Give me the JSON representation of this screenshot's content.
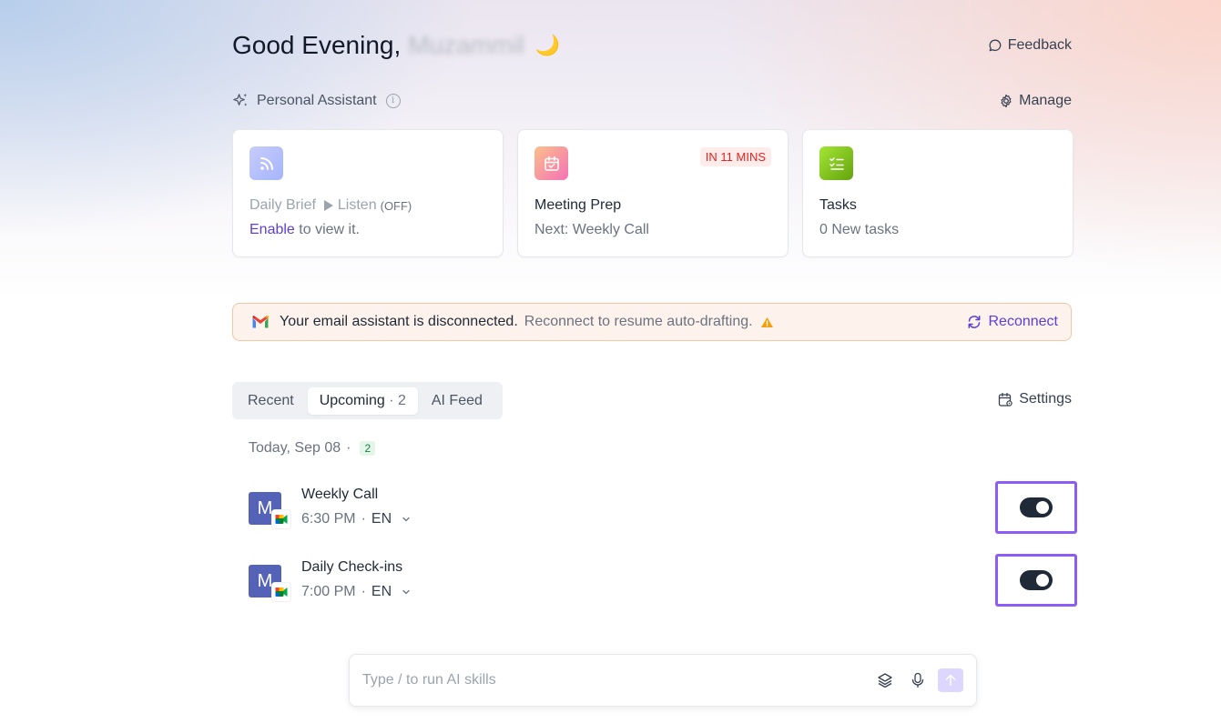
{
  "header": {
    "greeting": "Good Evening,",
    "user_name": "Muzammil",
    "moon": "🌙",
    "feedback_label": "Feedback"
  },
  "assistant": {
    "section_label": "Personal Assistant",
    "info_glyph": "i",
    "manage_label": "Manage"
  },
  "cards": {
    "daily_brief": {
      "title": "Daily Brief",
      "listen_label": "Listen",
      "listen_state": "(OFF)",
      "enable_link": "Enable",
      "enable_rest": "to view it."
    },
    "meeting_prep": {
      "badge": "IN 11 MINS",
      "title": "Meeting Prep",
      "subtitle": "Next: Weekly Call"
    },
    "tasks": {
      "title": "Tasks",
      "subtitle": "0 New tasks"
    }
  },
  "alert": {
    "strong_text": "Your email assistant is disconnected.",
    "light_text": "Reconnect to resume auto-drafting.",
    "reconnect_label": "Reconnect"
  },
  "tabs": {
    "recent": "Recent",
    "upcoming": "Upcoming",
    "upcoming_count": "· 2",
    "ai_feed": "AI Feed",
    "settings_label": "Settings"
  },
  "schedule": {
    "date_label": "Today, Sep 08",
    "separator": "·",
    "count": "2",
    "meetings": [
      {
        "avatar": "M",
        "title": "Weekly Call",
        "time": "6:30 PM",
        "dot": "·",
        "lang": "EN",
        "recording_on": true
      },
      {
        "avatar": "M",
        "title": "Daily Check-ins",
        "time": "7:00 PM",
        "dot": "·",
        "lang": "EN",
        "recording_on": true
      }
    ]
  },
  "composer": {
    "placeholder": "Type / to run AI skills"
  },
  "colors": {
    "accent": "#5b3fd6",
    "highlight": "#8b5cf6",
    "badge_red": "#dc2626",
    "avatar_blue": "#5463b8"
  }
}
